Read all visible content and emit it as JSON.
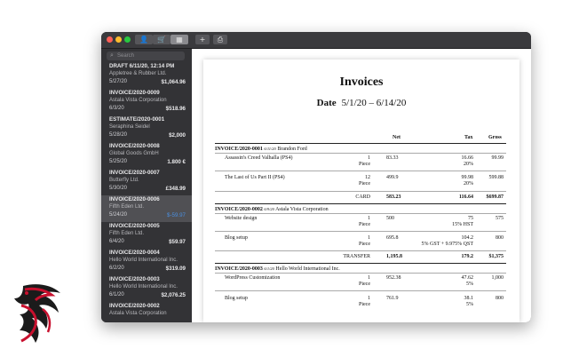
{
  "toolbar": {
    "add_label": "+",
    "print_label": "⎙",
    "people_icon": "👤",
    "cart_icon": "🛒",
    "grid_icon": "▦"
  },
  "sidebar": {
    "search_placeholder": "Search",
    "items": [
      {
        "title": "DRAFT 6/11/20, 12:14 PM",
        "client": "Appletree & Rubber Ltd.",
        "date": "5/27/20",
        "amount": "$1,064.96"
      },
      {
        "title": "INVOICE/2020-0009",
        "client": "Astala Vista Corporation",
        "date": "6/3/20",
        "amount": "$518.96"
      },
      {
        "title": "ESTIMATE/2020-0001",
        "client": "Seraphina Seidel",
        "date": "5/28/20",
        "amount": "$2,000"
      },
      {
        "title": "INVOICE/2020-0008",
        "client": "Global Goods GmbH",
        "date": "5/25/20",
        "amount": "1.800 €"
      },
      {
        "title": "INVOICE/2020-0007",
        "client": "Butterfly Ltd.",
        "date": "5/30/20",
        "amount": "£348.99"
      },
      {
        "title": "INVOICE/2020-0006",
        "client": "Fifth Eden Ltd.",
        "date": "5/24/20",
        "amount": "$-59.97"
      },
      {
        "title": "INVOICE/2020-0005",
        "client": "Fifth Eden Ltd.",
        "date": "6/4/20",
        "amount": "$59.97"
      },
      {
        "title": "INVOICE/2020-0004",
        "client": "Hello World International Inc.",
        "date": "6/2/20",
        "amount": "$319.09"
      },
      {
        "title": "INVOICE/2020-0003",
        "client": "Hello World International Inc.",
        "date": "6/1/20",
        "amount": "$2,076.25"
      },
      {
        "title": "INVOICE/2020-0002",
        "client": "Astala Vista Corporation",
        "date": "",
        "amount": ""
      }
    ]
  },
  "report": {
    "title": "Invoices",
    "date_label": "Date",
    "date_range": "5/1/20 – 6/14/20",
    "columns": {
      "net": "Net",
      "tax": "Tax",
      "gross": "Gross"
    },
    "invoices": [
      {
        "number": "INVOICE/2020-0001",
        "date": "6/11/20",
        "client": "Brandon Ford",
        "lines": [
          {
            "desc": "Assassin's Creed Valhalla (PS4)",
            "qty": "1",
            "unit": "Piece",
            "net": "83.33",
            "tax": "16.66",
            "tax_rate": "20%",
            "gross": "99.99"
          },
          {
            "desc": "The Last of Us Part II (PS4)",
            "qty": "12",
            "unit": "Piece",
            "net": "499.9",
            "tax": "99.98",
            "tax_rate": "20%",
            "gross": "599.88"
          }
        ],
        "total": {
          "method": "CARD",
          "net": "583.23",
          "tax": "116.64",
          "gross": "$699.87"
        }
      },
      {
        "number": "INVOICE/2020-0002",
        "date": "6/9/20",
        "client": "Astala Vista Corporation",
        "lines": [
          {
            "desc": "Website design",
            "qty": "1",
            "unit": "Piece",
            "net": "500",
            "tax": "75",
            "tax_rate": "15% HST",
            "gross": "575"
          },
          {
            "desc": "Blog setup",
            "qty": "1",
            "unit": "Piece",
            "net": "695.8",
            "tax": "104.2",
            "tax_rate": "5% GST + 9.975% QST",
            "gross": "800"
          }
        ],
        "total": {
          "method": "TRANSFER",
          "net": "1,195.8",
          "tax": "179.2",
          "gross": "$1,375"
        }
      },
      {
        "number": "INVOICE/2020-0003",
        "date": "6/1/20",
        "client": "Hello World International Inc.",
        "lines": [
          {
            "desc": "WordPress Customization",
            "qty": "1",
            "unit": "Piece",
            "net": "952.38",
            "tax": "47.62",
            "tax_rate": "5%",
            "gross": "1,000"
          },
          {
            "desc": "Blog setup",
            "qty": "1",
            "unit": "Piece",
            "net": "761.9",
            "tax": "38.1",
            "tax_rate": "5%",
            "gross": "800"
          }
        ]
      }
    ]
  },
  "colors": {
    "sidebar_bg": "#333336",
    "selected_bg": "#505054",
    "negative_amount": "#4a8fe0",
    "close": "#ff5f57",
    "minimize": "#febc2e",
    "zoom": "#28c840",
    "dragon_red": "#c8102e"
  }
}
